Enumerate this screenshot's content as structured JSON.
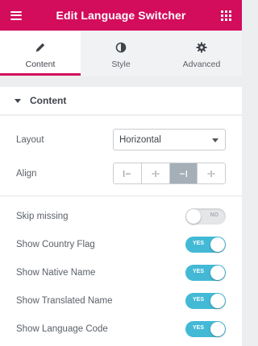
{
  "header": {
    "title": "Edit Language Switcher",
    "menu_icon": "hamburger-icon",
    "grid_icon": "apps-grid-icon",
    "color": "#d30c5c"
  },
  "tabs": [
    {
      "label": "Content",
      "icon": "pencil-icon",
      "active": true
    },
    {
      "label": "Style",
      "icon": "half-circle-icon",
      "active": false
    },
    {
      "label": "Advanced",
      "icon": "gear-icon",
      "active": false
    }
  ],
  "section": {
    "title": "Content",
    "icon": "caret-down-icon"
  },
  "layout": {
    "label": "Layout",
    "value": "Horizontal"
  },
  "align": {
    "label": "Align",
    "options": [
      "align-start-icon",
      "align-center-icon",
      "align-end-icon",
      "align-stretch-icon"
    ],
    "selected": 2
  },
  "toggles": [
    {
      "label": "Skip missing",
      "state": "NO",
      "on": false
    },
    {
      "label": "Show Country Flag",
      "state": "YES",
      "on": true
    },
    {
      "label": "Show Native Name",
      "state": "YES",
      "on": true
    },
    {
      "label": "Show Translated Name",
      "state": "YES",
      "on": true
    },
    {
      "label": "Show Language Code",
      "state": "YES",
      "on": true
    }
  ],
  "colors": {
    "toggle_on": "#43b9d6",
    "toggle_off": "#e4e6e8"
  }
}
